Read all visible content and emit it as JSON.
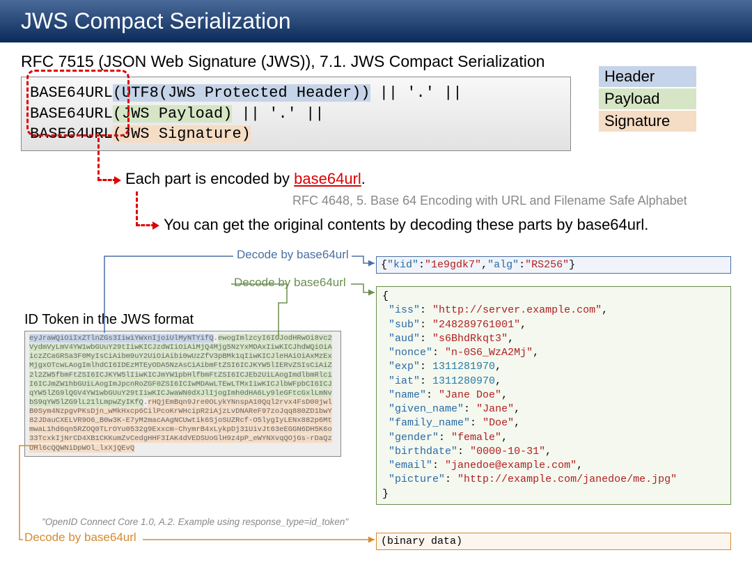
{
  "title": "JWS Compact Serialization",
  "rfc_title": "RFC 7515 (JSON Web Signature (JWS)), 7.1. JWS Compact Serialization",
  "syntax": {
    "b64": "BASE64URL",
    "line1_arg": "(UTF8(JWS Protected Header))",
    "concat": " || '.' ||",
    "line2_arg": "(JWS Payload)",
    "line3_arg": "(JWS Signature)"
  },
  "legend": {
    "header": "Header",
    "payload": "Payload",
    "signature": "Signature"
  },
  "note1_pre": "Each part is encoded by ",
  "note1_link": "base64url",
  "note1_post": ".",
  "rfc_ref": "RFC 4648, 5. Base 64 Encoding with URL and Filename Safe Alphabet",
  "note2": "You can get the original contents by decoding these parts by base64url.",
  "decode_labels": {
    "header": "Decode by base64url",
    "payload": "Decode by base64url",
    "signature": "Decode by base64url"
  },
  "token_title": "ID Token in the JWS format",
  "token": {
    "header": "eyJraWQiOiIxZTlnZGs3IiwiYWxnIjoiUlMyNTYifQ",
    "dot": ".",
    "payload": "ewogImlzcyI6ICJodHRwOi8vc2VydmVyLmV4YW1wbGUuY29tIiwKICJzdWIiOiAiMjQ4Mjg5NzYxMDAxIiwKICJhdWQiOiAiczZCaGRSa3F0MyIsCiAibm9uY2UiOiAibi0wUzZfV3pBMk1qIiwKICJleHAiOiAxMzExMjgxOTcwLAogImlhdCI6IDEzMTEyODA5NzAsCiAibmFtZSI6ICJKYW5lIERvZSIsCiAiZ2l2ZW5fbmFtZSI6ICJKYW5lIiwKICJmYW1pbHlfbmFtZSI6ICJEb2UiLAogImdlbmRlciI6ICJmZW1hbGUiLAogImJpcnRoZGF0ZSI6ICIwMDAwLTEwLTMxIiwKICJlbWFpbCI6ICJqYW5lZG9lQGV4YW1wbGUuY29tIiwKICJwaWN0dXJlIjogImh0dHA6Ly9leGFtcGxlLmNvbS9qYW5lZG9lL21lLmpwZyIKfQ",
    "signature": "rHQjEmBqn9Jre0OLykYNnspA10Qql2rvx4FsD00jwlB0Sym4NzpgvPKsDjn_wMkHxcp6CilPcoKrWHcipR2iAjzLvDNAReF97zoJqq880ZD1bwY82JDauCXELVR9O6_B0w3K-E7yM2macAAgNCUwtik6SjoSUZRcf-O5lygIyLENx882p6MtmwaL1hd6qn5RZOQ0TLrOYu0532g9Exxcm-ChymrB4xLykpDj31UivJt63eEGGN6DH5K6o33TcxkIjNrCD4XB1CKKumZvCedgHHF3IAK4dVEDSUoGlH9z4pP_eWYNXvqQOjGs-rDaQzUHl6cQQWNiDpWOl_lxXjQEvQ"
  },
  "cite": "\"OpenID Connect Core 1.0, A.2. Example using response_type=id_token\"",
  "decoded_header_raw": "{\"kid\":\"1e9gdk7\",\"alg\":\"RS256\"}",
  "decoded_payload": {
    "iss": "http://server.example.com",
    "sub": "248289761001",
    "aud": "s6BhdRkqt3",
    "nonce": "n-0S6_WzA2Mj",
    "exp": 1311281970,
    "iat": 1311280970,
    "name": "Jane Doe",
    "given_name": "Jane",
    "family_name": "Doe",
    "gender": "female",
    "birthdate": "0000-10-31",
    "email": "janedoe@example.com",
    "picture": "http://example.com/janedoe/me.jpg"
  },
  "decoded_sig": "(binary data)"
}
